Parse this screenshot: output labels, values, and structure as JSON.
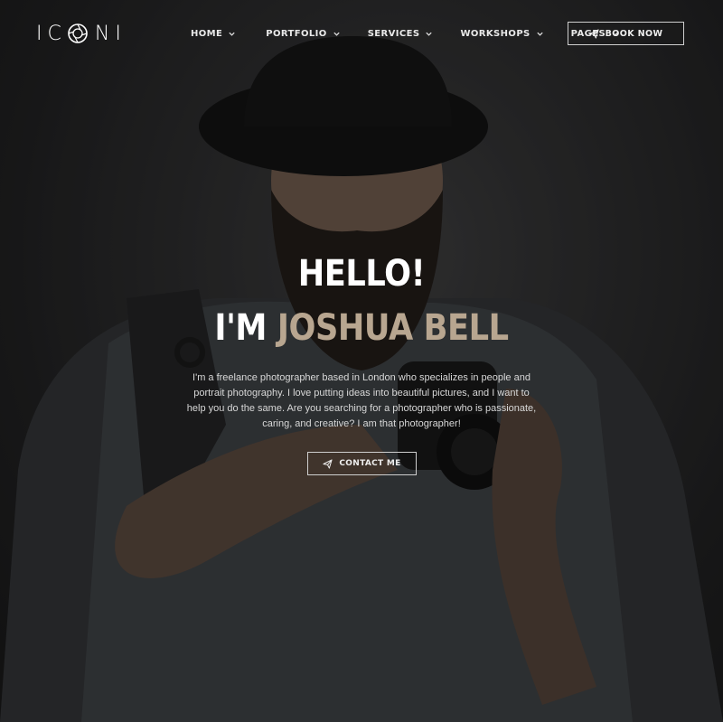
{
  "brand": {
    "logo_text_left": "IC",
    "logo_text_right": "NI"
  },
  "nav": {
    "items": [
      {
        "label": "HOME"
      },
      {
        "label": "PORTFOLIO"
      },
      {
        "label": "SERVICES"
      },
      {
        "label": "WORKSHOPS"
      },
      {
        "label": "PAGES"
      }
    ],
    "cta_label": "BOOK NOW"
  },
  "hero": {
    "greeting": "HELLO!",
    "intro_prefix": "I'M",
    "name": "JOSHUA BELL",
    "description": "I'm a freelance photographer based in London who specializes in people and portrait photography. I love putting ideas into beautiful pictures, and I want to help you do the same. Are you searching for a photographer who is passionate, caring, and creative? I am that photographer!",
    "cta_label": "CONTACT ME"
  },
  "colors": {
    "accent": "#b8a690",
    "text": "#ffffff",
    "background": "#1c1c1d"
  }
}
